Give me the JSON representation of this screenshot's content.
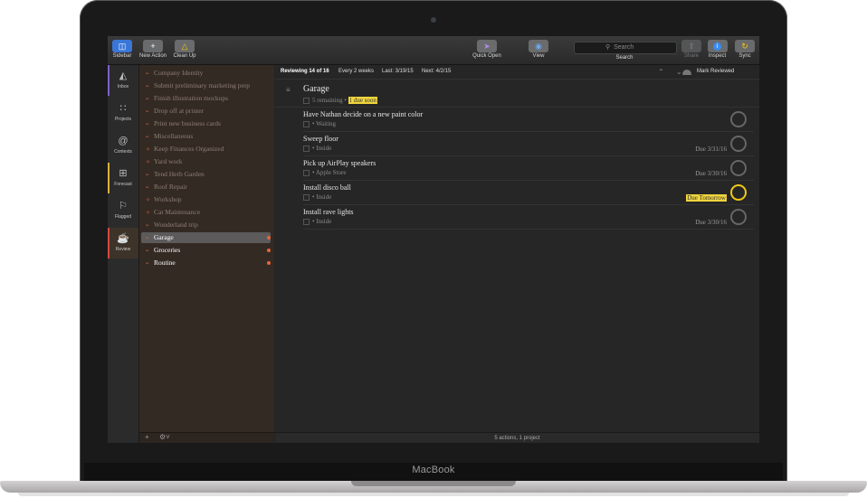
{
  "device": {
    "brand": "MacBook"
  },
  "toolbar": {
    "sidebar": {
      "label": "Sidebar",
      "icon": "sidebar-icon"
    },
    "new_action": {
      "label": "New Action",
      "icon": "plus-icon"
    },
    "clean_up": {
      "label": "Clean Up",
      "icon": "broom-icon"
    },
    "quick_open": {
      "label": "Quick Open",
      "icon": "arrow-icon"
    },
    "view": {
      "label": "View",
      "icon": "eye-icon"
    },
    "search": {
      "label": "Search",
      "placeholder": "Search"
    },
    "share": {
      "label": "Share",
      "icon": "share-icon",
      "enabled": false
    },
    "inspect": {
      "label": "Inspect",
      "icon": "info-icon"
    },
    "sync": {
      "label": "Sync",
      "icon": "sync-icon"
    }
  },
  "rail": [
    {
      "label": "Inbox",
      "icon": "inbox-icon",
      "accent": "#7b61c9"
    },
    {
      "label": "Projects",
      "icon": "projects-icon"
    },
    {
      "label": "Contexts",
      "icon": "contexts-icon"
    },
    {
      "label": "Forecast",
      "icon": "forecast-icon",
      "accent": "#d9b23a"
    },
    {
      "label": "Flagged",
      "icon": "flag-icon"
    },
    {
      "label": "Review",
      "icon": "review-icon",
      "accent": "#d4493a",
      "selected": true
    }
  ],
  "sidebar": {
    "items": [
      {
        "label": "Company Identity"
      },
      {
        "label": "Submit preliminary marketing prep"
      },
      {
        "label": "Finish illustration mockups"
      },
      {
        "label": "Drop off at printer"
      },
      {
        "label": "Print new business cards"
      },
      {
        "label": "Miscellaneous"
      },
      {
        "label": "Keep Finances Organized"
      },
      {
        "label": "Yard work"
      },
      {
        "label": "Tend Herb Garden"
      },
      {
        "label": "Roof Repair"
      },
      {
        "label": "Workshop"
      },
      {
        "label": "Cat Maintenance"
      },
      {
        "label": "Wonderland trip"
      },
      {
        "label": "Garage",
        "selected": true,
        "needs_review": true
      },
      {
        "label": "Groceries",
        "needs_review": true
      },
      {
        "label": "Routine",
        "needs_review": true
      }
    ]
  },
  "review_header": {
    "progress": "Reviewing 14 of 16",
    "interval": "Every 2 weeks",
    "last": "Last: 3/19/15",
    "next": "Next: 4/2/15",
    "mark_reviewed": "Mark Reviewed"
  },
  "project": {
    "title": "Garage",
    "remaining": "5 remaining",
    "separator": "•",
    "due_soon": "1 due soon"
  },
  "tasks": [
    {
      "title": "Have Nathan decide on a new paint color",
      "context": "• Waiting",
      "due": "",
      "highlight": false
    },
    {
      "title": "Sweep floor",
      "context": "• Inside",
      "due": "Due 3/31/16",
      "highlight": false
    },
    {
      "title": "Pick up AirPlay speakers",
      "context": "• Apple Store",
      "due": "Due 3/30/16",
      "highlight": false
    },
    {
      "title": "Install disco ball",
      "context": "• Inside",
      "due": "Due Tomorrow",
      "highlight": true
    },
    {
      "title": "Install rave lights",
      "context": "• Inside",
      "due": "Due 3/30/16",
      "highlight": false
    }
  ],
  "status": {
    "text": "5 actions, 1 project"
  },
  "colors": {
    "accent_due": "#f0d53c",
    "project_icon": "#d4673c",
    "review_dot": "#e5663a"
  }
}
